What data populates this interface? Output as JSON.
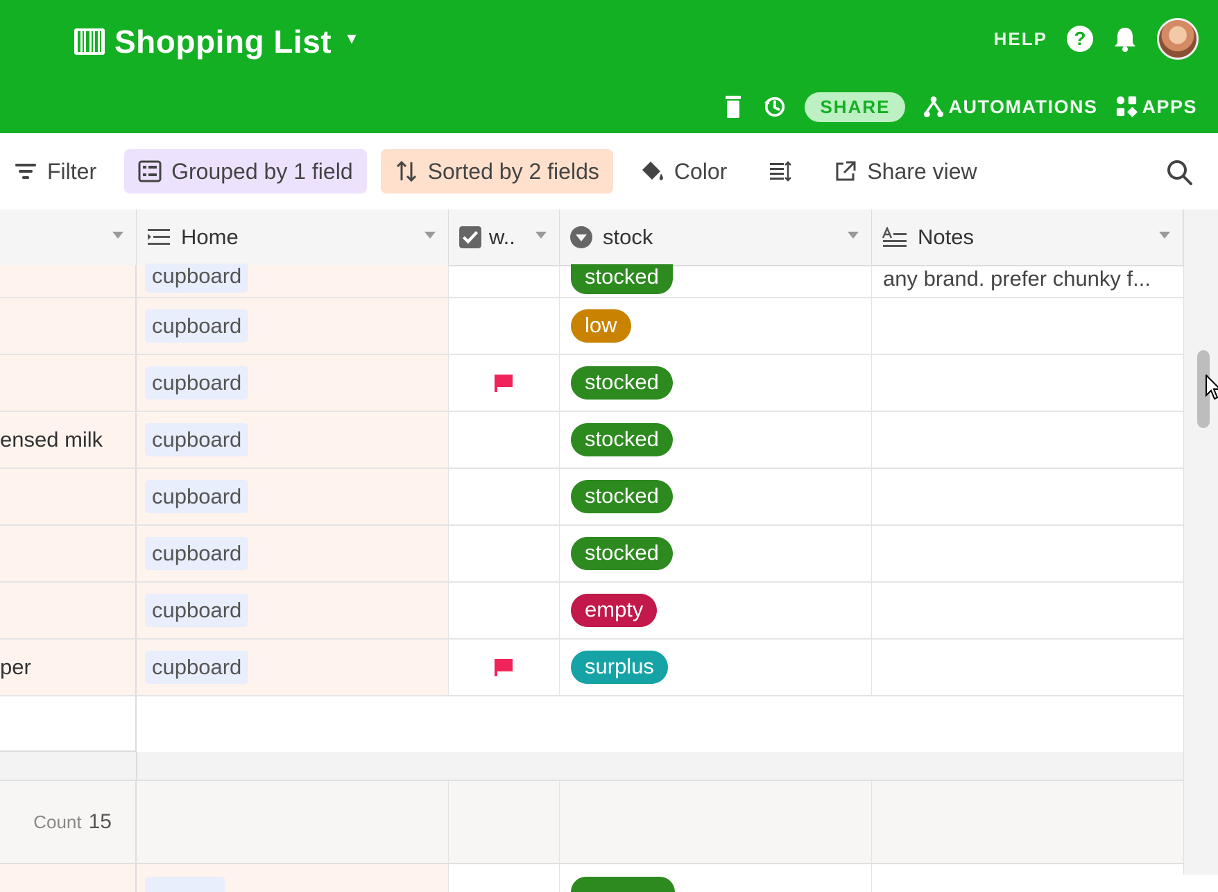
{
  "app": {
    "title": "Shopping List",
    "help_label": "HELP",
    "share_label": "SHARE",
    "automations_label": "AUTOMATIONS",
    "apps_label": "APPS",
    "header_color": "#14b023"
  },
  "viewbar": {
    "filter_label": "Filter",
    "grouped_label": "Grouped by 1 field",
    "sorted_label": "Sorted by 2 fields",
    "color_label": "Color",
    "share_view_label": "Share view"
  },
  "columns": {
    "home": "Home",
    "w": "w..",
    "stock": "stock",
    "notes": "Notes"
  },
  "rows": [
    {
      "name": "",
      "home": "cupboard",
      "flag": false,
      "stock": "stocked",
      "notes": "any brand. prefer chunky f..."
    },
    {
      "name": "",
      "home": "cupboard",
      "flag": false,
      "stock": "low",
      "notes": ""
    },
    {
      "name": "",
      "home": "cupboard",
      "flag": true,
      "stock": "stocked",
      "notes": ""
    },
    {
      "name": "ensed milk",
      "home": "cupboard",
      "flag": false,
      "stock": "stocked",
      "notes": ""
    },
    {
      "name": "",
      "home": "cupboard",
      "flag": false,
      "stock": "stocked",
      "notes": ""
    },
    {
      "name": "",
      "home": "cupboard",
      "flag": false,
      "stock": "stocked",
      "notes": ""
    },
    {
      "name": "",
      "home": "cupboard",
      "flag": false,
      "stock": "empty",
      "notes": ""
    },
    {
      "name": "per",
      "home": "cupboard",
      "flag": true,
      "stock": "surplus",
      "notes": ""
    }
  ],
  "stock_colors": {
    "stocked": "#2d8a1f",
    "low": "#c98300",
    "empty": "#c2184a",
    "surplus": "#16a3a6"
  },
  "flag_color": "#f0245a",
  "summary": {
    "count_label": "Count",
    "count_value": "15"
  }
}
